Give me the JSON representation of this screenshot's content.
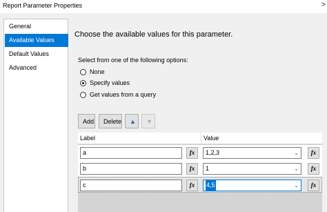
{
  "window": {
    "title": "Report Parameter Properties",
    "close_glyph": ">"
  },
  "sidebar": {
    "items": [
      {
        "label": "General",
        "selected": false
      },
      {
        "label": "Available Values",
        "selected": true
      },
      {
        "label": "Default Values",
        "selected": false
      },
      {
        "label": "Advanced",
        "selected": false
      }
    ]
  },
  "main": {
    "heading": "Choose the available values for this parameter.",
    "options_label": "Select from one of the following options:",
    "options": [
      {
        "label": "None",
        "checked": false
      },
      {
        "label": "Specify values",
        "checked": true
      },
      {
        "label": "Get values from a query",
        "checked": false
      }
    ]
  },
  "toolbar": {
    "add_label": "Add",
    "delete_label": "Delete",
    "move_up_icon": "arrow-up-icon",
    "move_down_icon": "arrow-down-icon"
  },
  "grid": {
    "columns": [
      "Label",
      "Value"
    ],
    "rows": [
      {
        "label": "a",
        "value": "1,2,3",
        "selected": false
      },
      {
        "label": "b",
        "value": "1",
        "selected": false
      },
      {
        "label": "c",
        "value": "4,5",
        "selected": true
      }
    ],
    "fx_label": "fx"
  },
  "colors": {
    "accent": "#0078d7",
    "window_bg": "#f0f0f0",
    "button_bg": "#e1e1e1"
  }
}
